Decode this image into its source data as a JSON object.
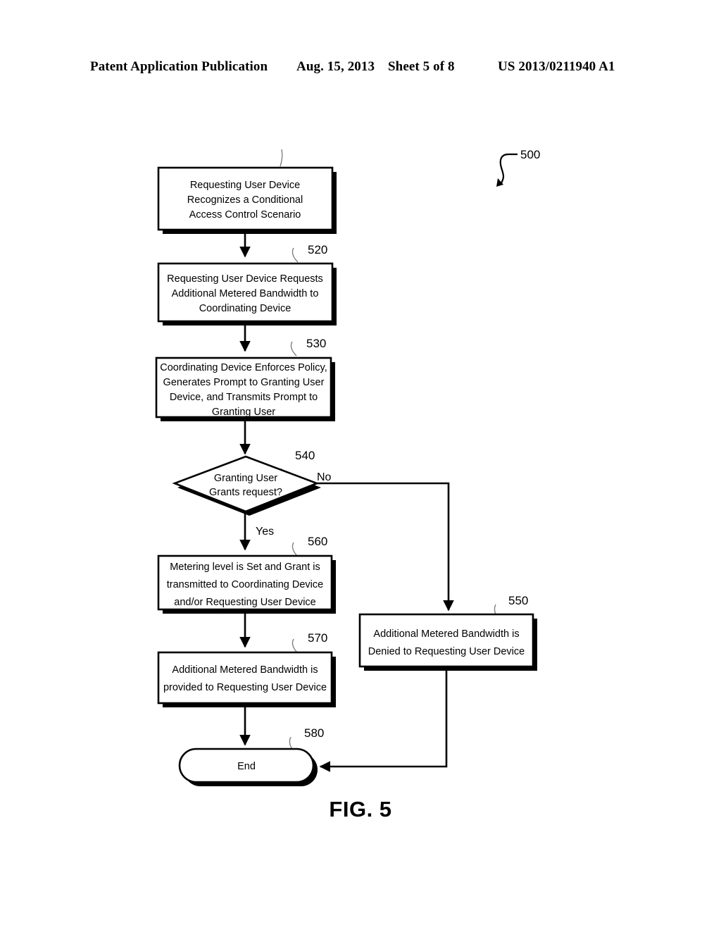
{
  "header": {
    "publication": "Patent Application Publication",
    "date": "Aug. 15, 2013",
    "sheet": "Sheet 5 of 8",
    "patent_number": "US 2013/0211940 A1"
  },
  "figure": {
    "caption": "FIG. 5",
    "diagram_ref": "500"
  },
  "flowchart": {
    "type": "flowchart",
    "nodes": [
      {
        "id": "510",
        "ref": "",
        "shape": "process",
        "lines": [
          "Requesting User Device",
          "Recognizes a Conditional",
          "Access Control Scenario"
        ]
      },
      {
        "id": "520",
        "ref": "520",
        "shape": "process",
        "lines": [
          "Requesting User Device Requests",
          "Additional Metered Bandwidth to",
          "Coordinating Device"
        ]
      },
      {
        "id": "530",
        "ref": "530",
        "shape": "process",
        "lines": [
          "Coordinating Device Enforces Policy,",
          "Generates Prompt to Granting User",
          "Device, and Transmits Prompt to",
          "Granting User"
        ]
      },
      {
        "id": "540",
        "ref": "540",
        "shape": "decision",
        "lines": [
          "Granting User",
          "Grants request?"
        ]
      },
      {
        "id": "560",
        "ref": "560",
        "shape": "process",
        "lines": [
          "Metering level is Set and Grant is",
          "transmitted to Coordinating Device",
          "and/or Requesting User Device"
        ]
      },
      {
        "id": "550",
        "ref": "550",
        "shape": "process",
        "lines": [
          "Additional Metered Bandwidth is",
          "Denied to Requesting User Device"
        ]
      },
      {
        "id": "570",
        "ref": "570",
        "shape": "process",
        "lines": [
          "Additional Metered Bandwidth is",
          "provided to Requesting User Device"
        ]
      },
      {
        "id": "580",
        "ref": "580",
        "shape": "terminator",
        "lines": [
          "End"
        ]
      }
    ],
    "branch_labels": {
      "no": "No",
      "yes": "Yes"
    }
  },
  "colors": {
    "ink": "#000000",
    "paper": "#ffffff",
    "leader": "#777777"
  }
}
